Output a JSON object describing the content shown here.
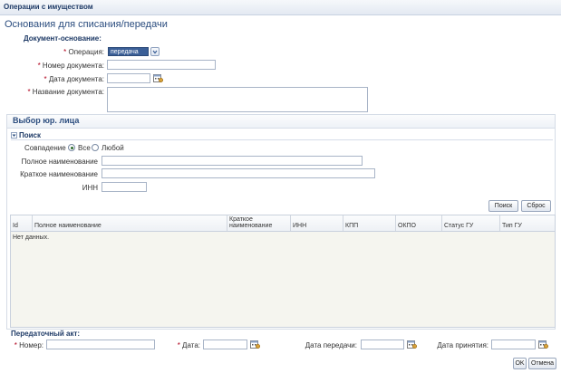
{
  "window": {
    "title": "Операции с имуществом"
  },
  "basis": {
    "section_title": "Основания для списания/передачи",
    "doc_group": "Документ-основание:",
    "operation_label": "* Операция:",
    "operation_value": "передача",
    "doc_number_label": "* Номер документа:",
    "doc_date_label": "* Дата документа:",
    "doc_name_label": "* Название документа:"
  },
  "legal": {
    "section_title": "Выбор юр. лица",
    "search_toggle": "Поиск",
    "match_label": "Совпадение",
    "match_options": [
      "Все",
      "Любой"
    ],
    "full_name_label": "Полное наименование",
    "short_name_label": "Краткое наименование",
    "inn_label": "ИНН",
    "search_button": "Поиск",
    "reset_button": "Сброс"
  },
  "table": {
    "columns": [
      "Id",
      "Полное наименование",
      "Краткое наименование",
      "ИНН",
      "КПП",
      "ОКПО",
      "Статус ГУ",
      "Тип ГУ"
    ],
    "empty_text": "Нет данных."
  },
  "transfer": {
    "title": "Передаточный акт:",
    "number_label": "* Номер:",
    "date_label": "* Дата:",
    "transfer_date_label": "Дата передачи:",
    "accept_date_label": "Дата принятия:"
  },
  "footer": {
    "ok": "OK",
    "cancel": "Отмена"
  },
  "icons": [
    "calendar-icon",
    "dropdown-arrow-icon",
    "collapse-triangle-icon"
  ]
}
